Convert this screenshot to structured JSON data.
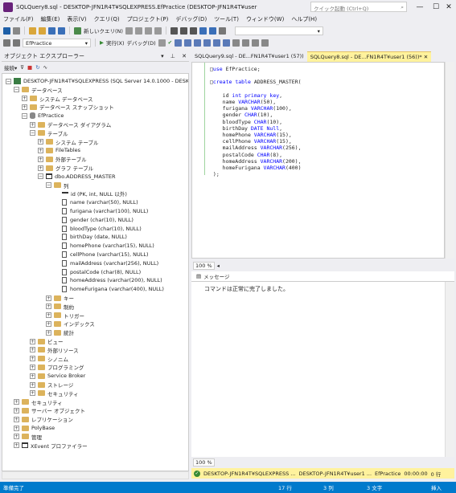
{
  "window": {
    "title": "SQLQuery8.sql - DESKTOP-JFN1R4T¥SQLEXPRESS.EfPractice (DESKTOP-JFN1R4T¥user1 (56))* - Microsoft SQL Serve...",
    "quick_launch": "クイック起動 (Ctrl+Q)"
  },
  "menu": [
    "ファイル(F)",
    "編集(E)",
    "表示(V)",
    "クエリ(Q)",
    "プロジェクト(P)",
    "デバッグ(D)",
    "ツール(T)",
    "ウィンドウ(W)",
    "ヘルプ(H)"
  ],
  "toolbar": {
    "new_query": "新しいクエリ(N)",
    "database": "EfPractice",
    "execute": "実行(X)",
    "debug": "デバッグ(D)"
  },
  "explorer": {
    "title": "オブジェクト エクスプローラー",
    "connect": "接続▾",
    "tree": [
      {
        "t": "DESKTOP-JFN1R4T¥SQLEXPRESS (SQL Server 14.0.1000 - DESKTOP",
        "lvl": 0,
        "exp": "−",
        "ic": "srv"
      },
      {
        "t": "データベース",
        "lvl": 1,
        "exp": "−",
        "ic": "folder"
      },
      {
        "t": "システム データベース",
        "lvl": 2,
        "exp": "+",
        "ic": "folder"
      },
      {
        "t": "データベース スナップショット",
        "lvl": 2,
        "exp": "+",
        "ic": "folder"
      },
      {
        "t": "EfPractice",
        "lvl": 2,
        "exp": "−",
        "ic": "db"
      },
      {
        "t": "データベース ダイアグラム",
        "lvl": 3,
        "exp": "+",
        "ic": "folder"
      },
      {
        "t": "テーブル",
        "lvl": 3,
        "exp": "−",
        "ic": "folder"
      },
      {
        "t": "システム テーブル",
        "lvl": 4,
        "exp": "+",
        "ic": "folder"
      },
      {
        "t": "FileTables",
        "lvl": 4,
        "exp": "+",
        "ic": "folder"
      },
      {
        "t": "外部テーブル",
        "lvl": 4,
        "exp": "+",
        "ic": "folder"
      },
      {
        "t": "グラフ テーブル",
        "lvl": 4,
        "exp": "+",
        "ic": "folder"
      },
      {
        "t": "dbo.ADDRESS_MASTER",
        "lvl": 4,
        "exp": "−",
        "ic": "tbl"
      },
      {
        "t": "列",
        "lvl": 5,
        "exp": "−",
        "ic": "folder"
      },
      {
        "t": "id (PK, int, NULL 以外)",
        "lvl": 6,
        "exp": "",
        "ic": "key"
      },
      {
        "t": "name (varchar(50), NULL)",
        "lvl": 6,
        "exp": "",
        "ic": "col"
      },
      {
        "t": "furigana (varchar(100), NULL)",
        "lvl": 6,
        "exp": "",
        "ic": "col"
      },
      {
        "t": "gender (char(10), NULL)",
        "lvl": 6,
        "exp": "",
        "ic": "col"
      },
      {
        "t": "bloodType (char(10), NULL)",
        "lvl": 6,
        "exp": "",
        "ic": "col"
      },
      {
        "t": "birthDay (date, NULL)",
        "lvl": 6,
        "exp": "",
        "ic": "col"
      },
      {
        "t": "homePhone (varchar(15), NULL)",
        "lvl": 6,
        "exp": "",
        "ic": "col"
      },
      {
        "t": "cellPhone (varchar(15), NULL)",
        "lvl": 6,
        "exp": "",
        "ic": "col"
      },
      {
        "t": "mailAddress (varchar(256), NULL)",
        "lvl": 6,
        "exp": "",
        "ic": "col"
      },
      {
        "t": "postalCode (char(8), NULL)",
        "lvl": 6,
        "exp": "",
        "ic": "col"
      },
      {
        "t": "homeAddress (varchar(200), NULL)",
        "lvl": 6,
        "exp": "",
        "ic": "col"
      },
      {
        "t": "homeFurigana (varchar(400), NULL)",
        "lvl": 6,
        "exp": "",
        "ic": "col"
      },
      {
        "t": "キー",
        "lvl": 5,
        "exp": "+",
        "ic": "folder"
      },
      {
        "t": "制約",
        "lvl": 5,
        "exp": "+",
        "ic": "folder"
      },
      {
        "t": "トリガー",
        "lvl": 5,
        "exp": "+",
        "ic": "folder"
      },
      {
        "t": "インデックス",
        "lvl": 5,
        "exp": "+",
        "ic": "folder"
      },
      {
        "t": "統計",
        "lvl": 5,
        "exp": "+",
        "ic": "folder"
      },
      {
        "t": "ビュー",
        "lvl": 3,
        "exp": "+",
        "ic": "folder"
      },
      {
        "t": "外部リソース",
        "lvl": 3,
        "exp": "+",
        "ic": "folder"
      },
      {
        "t": "シノニム",
        "lvl": 3,
        "exp": "+",
        "ic": "folder"
      },
      {
        "t": "プログラミング",
        "lvl": 3,
        "exp": "+",
        "ic": "folder"
      },
      {
        "t": "Service Broker",
        "lvl": 3,
        "exp": "+",
        "ic": "folder"
      },
      {
        "t": "ストレージ",
        "lvl": 3,
        "exp": "+",
        "ic": "folder"
      },
      {
        "t": "セキュリティ",
        "lvl": 3,
        "exp": "+",
        "ic": "folder"
      },
      {
        "t": "セキュリティ",
        "lvl": 1,
        "exp": "+",
        "ic": "folder"
      },
      {
        "t": "サーバー オブジェクト",
        "lvl": 1,
        "exp": "+",
        "ic": "folder"
      },
      {
        "t": "レプリケーション",
        "lvl": 1,
        "exp": "+",
        "ic": "folder"
      },
      {
        "t": "PolyBase",
        "lvl": 1,
        "exp": "+",
        "ic": "folder"
      },
      {
        "t": "管理",
        "lvl": 1,
        "exp": "+",
        "ic": "folder"
      },
      {
        "t": "XEvent プロファイラー",
        "lvl": 1,
        "exp": "+",
        "ic": "xe"
      }
    ]
  },
  "tabs": [
    {
      "label": "SQLQuery9.sql - DE...FN1R4T¥user1 (57))",
      "active": false
    },
    {
      "label": "SQLQuery8.sql - DE...FN1R4T¥user1 (56))*",
      "active": true
    }
  ],
  "code": [
    "□use EfPractice;",
    "",
    "□create table ADDRESS_MASTER(",
    "",
    "    id int primary key,",
    "    name VARCHAR(50),",
    "    furigana VARCHAR(100),",
    "    gender CHAR(10),",
    "    bloodType CHAR(10),",
    "    birthDay DATE Null,",
    "    homePhone VARCHAR(15),",
    "    cellPhone VARCHAR(15),",
    "    mailAddress VARCHAR(256),",
    "    postalCode CHAR(8),",
    "    homeAddress VARCHAR(200),",
    "    homeFurigana VARCHAR(400)",
    " );"
  ],
  "zoom": "100 %",
  "messages": {
    "tab": "メッセージ",
    "text": "コマンドは正常に完了しました。"
  },
  "status": {
    "server": "DESKTOP-JFN1R4T¥SQLEXPRESS ...",
    "user": "DESKTOP-JFN1R4T¥user1 ...",
    "db": "EfPractice",
    "time": "00:00:00",
    "rows": "0 行"
  },
  "bottom": {
    "ready": "準備完了",
    "line": "17 行",
    "col": "3 列",
    "ch": "3 文字",
    "mode": "挿入"
  }
}
